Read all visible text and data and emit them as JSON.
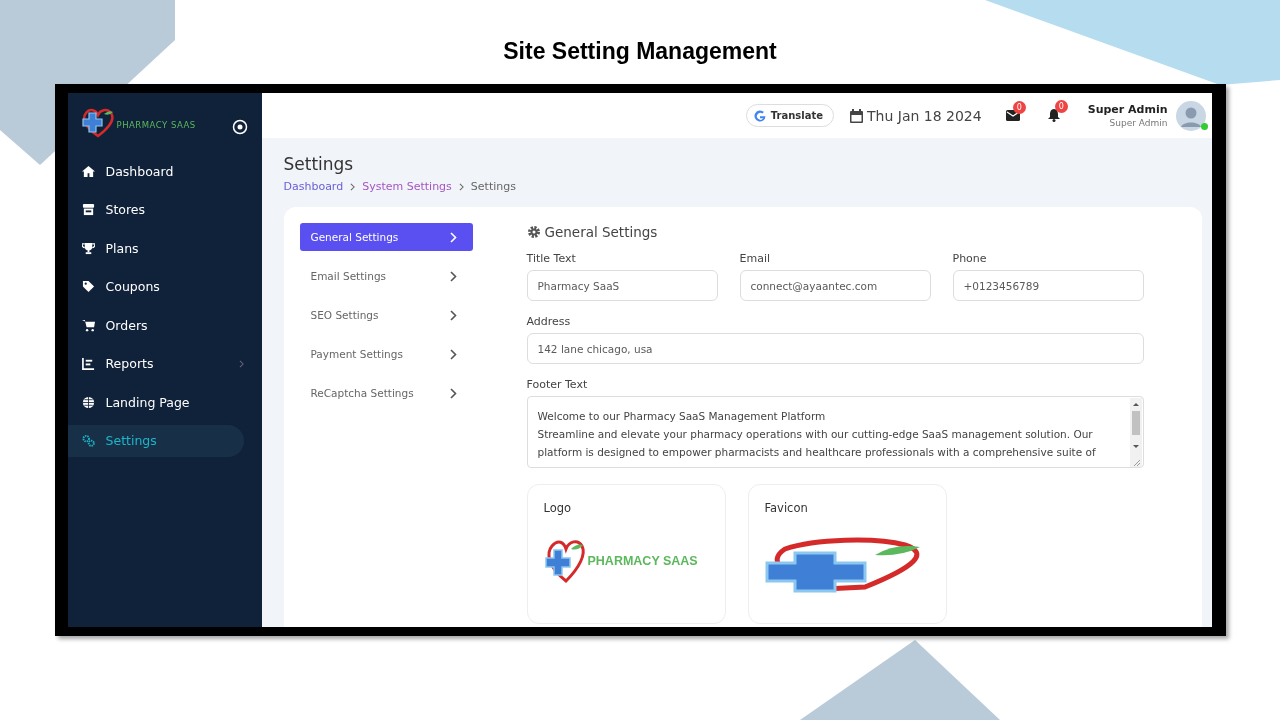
{
  "slide_title": "Site Setting Management",
  "sidebar": {
    "brand": "PHARMACY SAAS",
    "items": [
      {
        "label": "Dashboard",
        "selected": false,
        "has_submenu": false
      },
      {
        "label": "Stores",
        "selected": false,
        "has_submenu": false
      },
      {
        "label": "Plans",
        "selected": false,
        "has_submenu": false
      },
      {
        "label": "Coupons",
        "selected": false,
        "has_submenu": false
      },
      {
        "label": "Orders",
        "selected": false,
        "has_submenu": false
      },
      {
        "label": "Reports",
        "selected": false,
        "has_submenu": true
      },
      {
        "label": "Landing Page",
        "selected": false,
        "has_submenu": false
      },
      {
        "label": "Settings",
        "selected": true,
        "has_submenu": false
      }
    ]
  },
  "topbar": {
    "translate": "Translate",
    "date": "Thu Jan 18 2024",
    "mail_count": "0",
    "notification_count": "0",
    "user_name": "Super Admin",
    "user_role": "Super Admin",
    "online": true
  },
  "page": {
    "title": "Settings",
    "breadcrumb": [
      {
        "label": "Dashboard",
        "kind": "link",
        "color": "#6a5fd6"
      },
      {
        "label": "System Settings",
        "kind": "link",
        "color": "#a456c4"
      },
      {
        "label": "Settings",
        "kind": "current"
      }
    ]
  },
  "settings_menu": [
    {
      "label": "General Settings",
      "selected": true
    },
    {
      "label": "Email Settings",
      "selected": false
    },
    {
      "label": "SEO Settings",
      "selected": false
    },
    {
      "label": "Payment Settings",
      "selected": false
    },
    {
      "label": "ReCaptcha Settings",
      "selected": false
    }
  ],
  "form": {
    "title": "General Settings",
    "fields": [
      {
        "label": "Title Text",
        "kind": "input",
        "value": "Pharmacy SaaS"
      },
      {
        "label": "Email",
        "kind": "input",
        "value": "connect@ayaantec.com"
      },
      {
        "label": "Phone",
        "kind": "input",
        "value": "+0123456789"
      },
      {
        "label": "Address",
        "kind": "wide_input",
        "value": "142 lane chicago, usa"
      },
      {
        "label": "Footer Text",
        "kind": "textarea",
        "value": "Welcome to our Pharmacy SaaS Management Platform\nStreamline and elevate your pharmacy operations with our cutting-edge SaaS management solution. Our platform is designed to empower pharmacists and healthcare professionals with a comprehensive suite of"
      }
    ]
  },
  "images": [
    {
      "label": "Logo",
      "kind": "logo",
      "text": "PHARMACY SAAS"
    },
    {
      "label": "Favicon",
      "kind": "favicon"
    }
  ]
}
